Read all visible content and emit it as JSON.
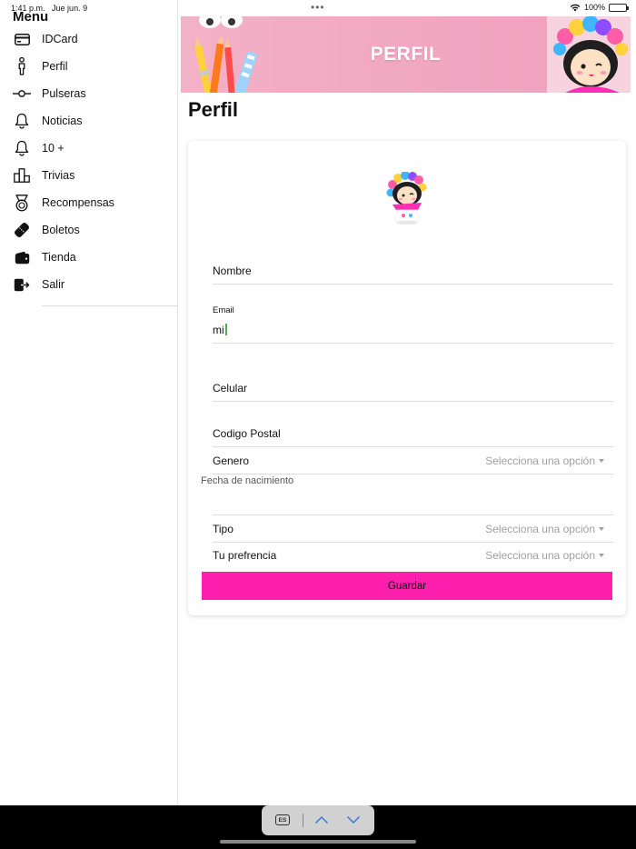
{
  "status_bar": {
    "time": "1:41 p.m.",
    "date": "Jue jun. 9",
    "dots": "•••",
    "battery": "100%"
  },
  "sidebar": {
    "title": "Menu",
    "items": [
      {
        "label": "IDCard",
        "icon": "id-card-icon"
      },
      {
        "label": "Perfil",
        "icon": "person-icon"
      },
      {
        "label": "Pulseras",
        "icon": "commit-icon"
      },
      {
        "label": "Noticias",
        "icon": "bell-icon"
      },
      {
        "label": "10 +",
        "icon": "bell-icon"
      },
      {
        "label": "Trivias",
        "icon": "podium-icon"
      },
      {
        "label": "Recompensas",
        "icon": "medal-icon"
      },
      {
        "label": "Boletos",
        "icon": "ticket-icon"
      },
      {
        "label": "Tienda",
        "icon": "wallet-icon"
      },
      {
        "label": "Salir",
        "icon": "exit-icon"
      }
    ]
  },
  "banner": {
    "title": "PERFIL",
    "background": "#f3b1c6"
  },
  "page": {
    "title": "Perfil"
  },
  "form": {
    "nombre_label": "Nombre",
    "email_label": "Email",
    "email_value": "mi",
    "celular_label": "Celular",
    "codigo_postal_label": "Codigo Postal",
    "genero_label": "Genero",
    "genero_value": "Selecciona una opción",
    "fecha_label": "Fecha de nacimiento",
    "tipo_label": "Tipo",
    "tipo_value": "Selecciona una opción",
    "preferencia_label": "Tu prefrencia",
    "preferencia_value": "Selecciona una opción",
    "save_label": "Guardar",
    "save_color": "#ff1fae"
  },
  "keyboard_bar": {
    "language": "ES"
  }
}
